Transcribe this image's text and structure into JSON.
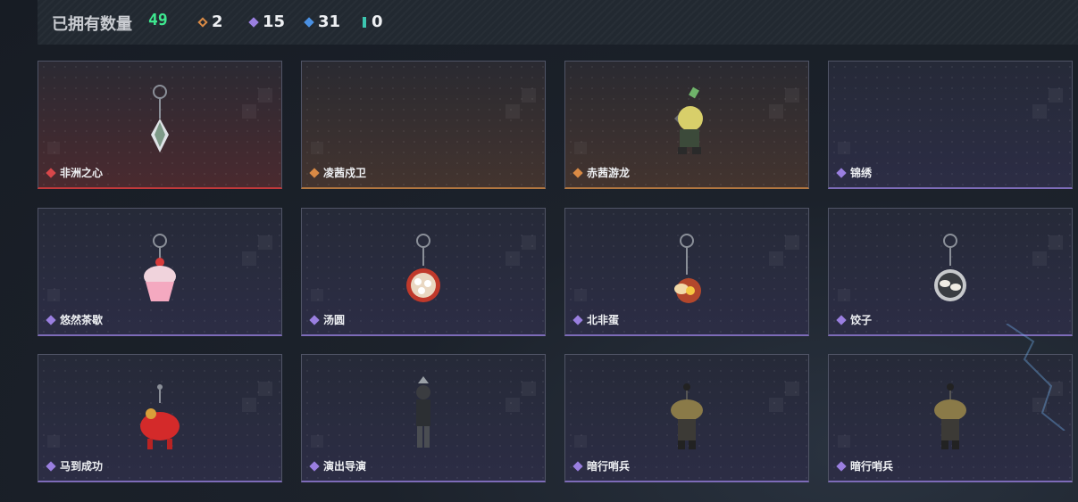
{
  "header": {
    "owned_label": "已拥有数量",
    "owned_count": "49",
    "stats": [
      {
        "icon": "orange-gem-icon",
        "color": "#d98a45",
        "value": "2"
      },
      {
        "icon": "purple-gem-icon",
        "color": "#9a7fe0",
        "value": "15"
      },
      {
        "icon": "blue-gem-icon",
        "color": "#4a90e2",
        "value": "31"
      },
      {
        "icon": "teal-gem-icon",
        "color": "#3cc6b0",
        "value": "0"
      }
    ]
  },
  "cards": [
    {
      "name": "非洲之心",
      "rarity": "red",
      "item_icon": "crystal-keychain-icon"
    },
    {
      "name": "凌茜戍卫",
      "rarity": "orange",
      "item_icon": ""
    },
    {
      "name": "赤茜游龙",
      "rarity": "orange",
      "item_icon": "dragon-figure-icon"
    },
    {
      "name": "锦绣",
      "rarity": "purple",
      "item_icon": ""
    },
    {
      "name": "悠然茶歇",
      "rarity": "purple",
      "item_icon": "cupcake-keychain-icon"
    },
    {
      "name": "汤圆",
      "rarity": "purple",
      "item_icon": "tangyuan-bowl-keychain-icon"
    },
    {
      "name": "北非蛋",
      "rarity": "purple",
      "item_icon": "egg-dish-keychain-icon"
    },
    {
      "name": "饺子",
      "rarity": "purple",
      "item_icon": "dumpling-plate-keychain-icon"
    },
    {
      "name": "马到成功",
      "rarity": "purple",
      "item_icon": "red-horse-keychain-icon"
    },
    {
      "name": "演出导演",
      "rarity": "purple",
      "item_icon": "director-figure-icon"
    },
    {
      "name": "暗行哨兵",
      "rarity": "purple",
      "item_icon": "sentinel-figure-icon"
    },
    {
      "name": "暗行哨兵",
      "rarity": "purple",
      "item_icon": "sentinel-figure-icon"
    }
  ]
}
